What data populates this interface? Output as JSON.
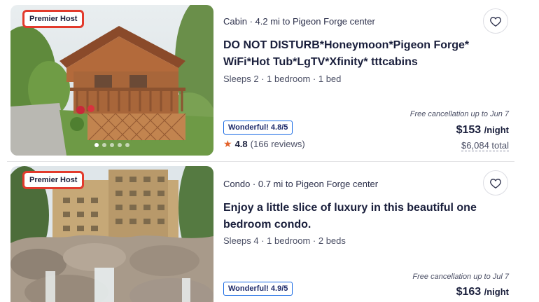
{
  "listings": [
    {
      "badge": "Premier Host",
      "meta": "Cabin · 4.2 mi to Pigeon Forge center",
      "title": "DO NOT DISTURB*Honeymoon*Pigeon Forge* WiFi*Hot Tub*LgTV*Xfinity* tttcabins",
      "sleeps": "Sleeps 2 · 1 bedroom · 1 bed",
      "rating_badge": "Wonderful! 4.8/5",
      "star_score": "4.8",
      "reviews": "(166 reviews)",
      "cancellation": "Free cancellation up to Jun 7",
      "price": "$153",
      "price_unit": "/night",
      "total": "$6,084 total",
      "photo_dots": 5,
      "photo_index": 1
    },
    {
      "badge": "Premier Host",
      "meta": "Condo · 0.7 mi to Pigeon Forge center",
      "title": "Enjoy a little slice of luxury in this beautiful one bedroom condo.",
      "sleeps": "Sleeps 4 · 1 bedroom · 2 beds",
      "rating_badge": "Wonderful! 4.9/5",
      "cancellation": "Free cancellation up to Jul 7",
      "price": "$163",
      "price_unit": "/night"
    }
  ],
  "icons": {
    "favorite": "heart-outline-icon",
    "star": "star-icon"
  },
  "colors": {
    "highlight_outline": "#e23a2c",
    "rating_border": "#1668e3",
    "star": "#e3632b",
    "text_primary": "#191e3b"
  }
}
